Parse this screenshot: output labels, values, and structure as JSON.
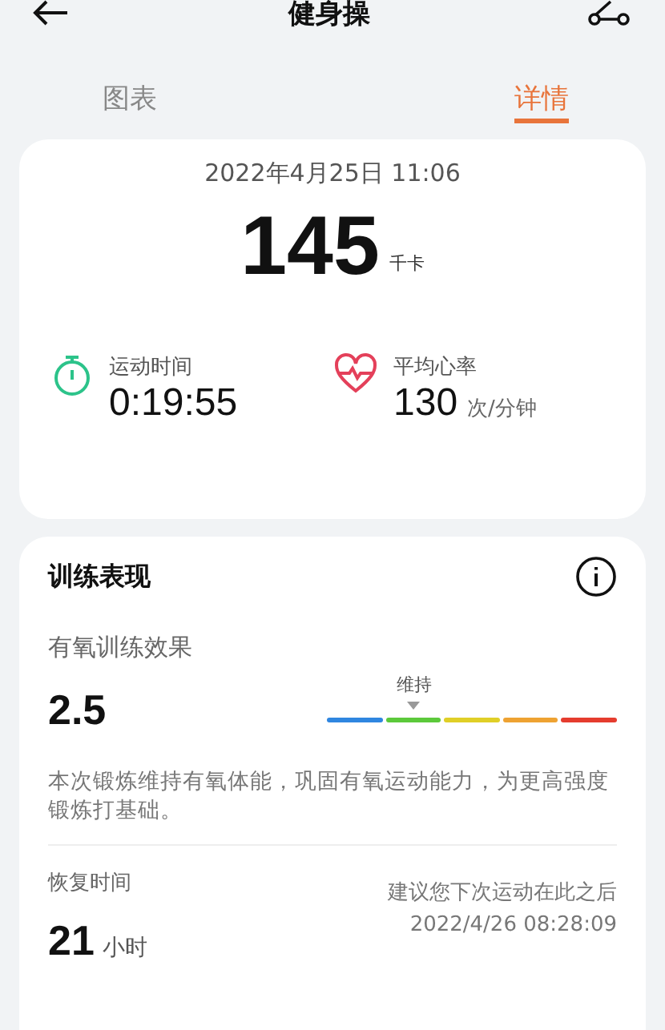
{
  "header": {
    "title": "健身操"
  },
  "tabs": [
    {
      "label": "图表",
      "selected": false
    },
    {
      "label": "详情",
      "selected": true
    }
  ],
  "summary": {
    "datetime": "2022年4月25日 11:06",
    "calories": "145",
    "calories_unit": "千卡",
    "stats": [
      {
        "kind": "duration",
        "label": "运动时间",
        "value": "0:19:55"
      },
      {
        "kind": "heart",
        "label": "平均心率",
        "value": "130",
        "unit": "次/分钟"
      }
    ]
  },
  "performance": {
    "title": "训练表现",
    "aerobic": {
      "label": "有氧训练效果",
      "value": "2.5",
      "scale_label": "维持",
      "description": "本次锻炼维持有氧体能，巩固有氧运动能力，为更高强度锻炼打基础。"
    },
    "recovery": {
      "label": "恢复时间",
      "value": "21",
      "unit": "小时",
      "note": "建议您下次运动在此之后",
      "time": "2022/4/26 08:28:09"
    }
  }
}
